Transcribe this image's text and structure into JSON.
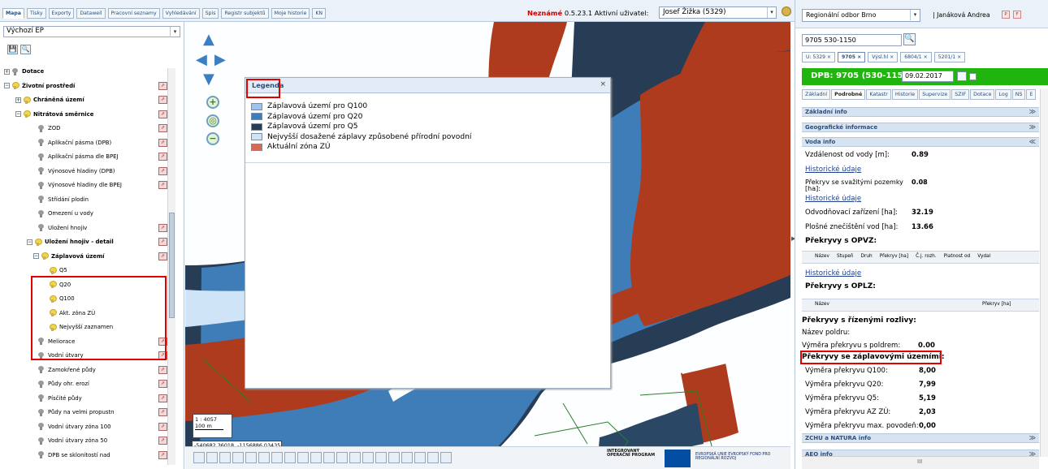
{
  "tabs": [
    "Mapa",
    "Tisky",
    "Exporty",
    "Dataweil",
    "Pracovní seznamy",
    "Vyhledávání",
    "Spis",
    "Registr subjektů",
    "Moje historie",
    "KN"
  ],
  "status": {
    "label": "Neznámé",
    "version": "0.5.23.1",
    "user_label": "Aktivní uživatel:",
    "user": "Josef Žižka (5329)"
  },
  "left": {
    "select": "Výchozí EP",
    "button1": "💾",
    "button2": "🔍"
  },
  "tree": [
    {
      "label": "Dotace",
      "indent": 0,
      "bold": true,
      "bulb": "gray",
      "expander": "+",
      "icon": false
    },
    {
      "label": "Životní prostředí",
      "indent": 0,
      "bold": true,
      "bulb": "y",
      "expander": "-",
      "icon": true
    },
    {
      "label": "Chráněná území",
      "indent": 14,
      "bold": true,
      "bulb": "y",
      "expander": "+",
      "icon": true
    },
    {
      "label": "Nitrátová směrnice",
      "indent": 14,
      "bold": true,
      "bulb": "y",
      "expander": "-",
      "icon": true
    },
    {
      "label": "ZOD",
      "indent": 42,
      "bold": false,
      "bulb": "gray",
      "expander": "",
      "icon": true
    },
    {
      "label": "Aplikační pásma (DPB)",
      "indent": 42,
      "bold": false,
      "bulb": "gray",
      "expander": "",
      "icon": true
    },
    {
      "label": "Aplikační pásma dle BPEJ",
      "indent": 42,
      "bold": false,
      "bulb": "gray",
      "expander": "",
      "icon": true
    },
    {
      "label": "Výnosové hladiny (DPB)",
      "indent": 42,
      "bold": false,
      "bulb": "gray",
      "expander": "",
      "icon": true
    },
    {
      "label": "Výnosové hladiny dle BPEJ",
      "indent": 42,
      "bold": false,
      "bulb": "gray",
      "expander": "",
      "icon": true
    },
    {
      "label": "Střídání plodin",
      "indent": 42,
      "bold": false,
      "bulb": "gray",
      "expander": "",
      "icon": false
    },
    {
      "label": "Omezení u vody",
      "indent": 42,
      "bold": false,
      "bulb": "gray",
      "expander": "",
      "icon": false
    },
    {
      "label": "Uložení hnojiv",
      "indent": 42,
      "bold": false,
      "bulb": "gray",
      "expander": "",
      "icon": true
    },
    {
      "label": "Uložení hnojiv - detail",
      "indent": 28,
      "bold": true,
      "bulb": "y",
      "expander": "-",
      "icon": true
    },
    {
      "label": "Záplavová území",
      "indent": 36,
      "bold": true,
      "bulb": "y",
      "expander": "-",
      "icon": true
    },
    {
      "label": "Q5",
      "indent": 56,
      "bold": false,
      "bulb": "y",
      "expander": "",
      "icon": false
    },
    {
      "label": "Q20",
      "indent": 56,
      "bold": false,
      "bulb": "y",
      "expander": "",
      "icon": false
    },
    {
      "label": "Q100",
      "indent": 56,
      "bold": false,
      "bulb": "y",
      "expander": "",
      "icon": false
    },
    {
      "label": "Akt. zóna ZÚ",
      "indent": 56,
      "bold": false,
      "bulb": "y",
      "expander": "",
      "icon": false
    },
    {
      "label": "Nejvyšší zaznamen",
      "indent": 56,
      "bold": false,
      "bulb": "y",
      "expander": "",
      "icon": false
    },
    {
      "label": "Meliorace",
      "indent": 42,
      "bold": false,
      "bulb": "gray",
      "expander": "",
      "icon": true
    },
    {
      "label": "Vodní útvary",
      "indent": 42,
      "bold": false,
      "bulb": "gray",
      "expander": "",
      "icon": true
    },
    {
      "label": "Zamokřené půdy",
      "indent": 42,
      "bold": false,
      "bulb": "gray",
      "expander": "",
      "icon": true
    },
    {
      "label": "Půdy ohr. erozí",
      "indent": 42,
      "bold": false,
      "bulb": "gray",
      "expander": "",
      "icon": true
    },
    {
      "label": "Písčité půdy",
      "indent": 42,
      "bold": false,
      "bulb": "gray",
      "expander": "",
      "icon": true
    },
    {
      "label": "Půdy na velmi propustn",
      "indent": 42,
      "bold": false,
      "bulb": "gray",
      "expander": "",
      "icon": true
    },
    {
      "label": "Vodní útvary zóna 100",
      "indent": 42,
      "bold": false,
      "bulb": "gray",
      "expander": "",
      "icon": true
    },
    {
      "label": "Vodní útvary zóna 50",
      "indent": 42,
      "bold": false,
      "bulb": "gray",
      "expander": "",
      "icon": true
    },
    {
      "label": "DPB se sklonitostí nad",
      "indent": 42,
      "bold": false,
      "bulb": "gray",
      "expander": "",
      "icon": true
    }
  ],
  "legend": {
    "title": "Legenda",
    "close": "×",
    "items": [
      {
        "label": "Záplavová území pro Q100",
        "color": "#9fc3ea"
      },
      {
        "label": "Záplavová území pro Q20",
        "color": "#3f7db8"
      },
      {
        "label": "Záplavová území pro Q5",
        "color": "#273d55"
      },
      {
        "label": "Nejvyšší dosažené záplavy způsobené přírodní povodní",
        "color": "#cfe4f6"
      },
      {
        "label": "Aktuální zóna ZÚ",
        "color": "#d86a55"
      }
    ]
  },
  "map": {
    "scale": "1 : 4057",
    "scalebar": "100 m",
    "coords": "-540682.36018, -1156886.03435"
  },
  "right": {
    "region": "Regionální odbor Brno",
    "user": "| Janáková Andrea",
    "btn_p": "P",
    "btn_f": "F",
    "search": "9705 530-1150",
    "search_icon": "🔍",
    "itabs": [
      "U: 5329 ×",
      "9705 ×",
      "Výsl.hl ×",
      "6804/1 ×",
      "5201/1 ×"
    ],
    "dpb": "DPB: 9705 (530-1150)",
    "date": "09.02.2017",
    "subtabs": [
      "Základní",
      "Podrobné",
      "Katastr",
      "Historie",
      "Supervize",
      "SZIF",
      "Dotace",
      "Log",
      "NS",
      "E"
    ],
    "sections": [
      "Základní info",
      "Geografické informace",
      "Voda info",
      "ZCHU a NATURA info",
      "AEO info"
    ],
    "rows": [
      {
        "label": "Vzdálenost od vody [m]:",
        "value": "0.89"
      },
      {
        "label": "Překryv se svažitými pozemky [ha]:",
        "value": "0.08"
      },
      {
        "label": "Odvodňovací zařízení [ha]:",
        "value": "32.19"
      },
      {
        "label": "Plošné znečištění vod [ha]:",
        "value": "13.66"
      }
    ],
    "hist_link": "Historické údaje",
    "opvz": "Překryvy s OPVZ:",
    "opvz_cols": [
      "Název",
      "Stupeň",
      "Druh",
      "Překryv [ha]",
      "Č.j. rozh.",
      "Platnost od",
      "Vydal"
    ],
    "oplz": "Překryvy s OPLZ:",
    "oplz_cols": [
      "Název",
      "Překryv [ha]"
    ],
    "rizene": "Překryvy s řízenými rozlivy:",
    "poldr_name": "Název poldru:",
    "poldr_area": "Výměra překryvu s poldrem:",
    "poldr_val": "0.00",
    "zapl": "Překryvy se záplavovými územími:",
    "zaprows": [
      {
        "label": "Výměra překryvu Q100:",
        "value": "8,00"
      },
      {
        "label": "Výměra překryvu Q20:",
        "value": "7,99"
      },
      {
        "label": "Výměra překryvu Q5:",
        "value": "5,19"
      },
      {
        "label": "Výměra překryvu AZ ZÚ:",
        "value": "2,03"
      },
      {
        "label": "Výměra překryvu max. povodeň:",
        "value": "0,00"
      }
    ],
    "hscroll": "III"
  },
  "bottom": {
    "logo1": "INTEGROVANÝ OPERAČNÍ PROGRAM",
    "logo2": "EVROPSKÁ UNIE EVROPSKÝ FOND PRO REGIONÁLNÍ ROZVOJ"
  }
}
